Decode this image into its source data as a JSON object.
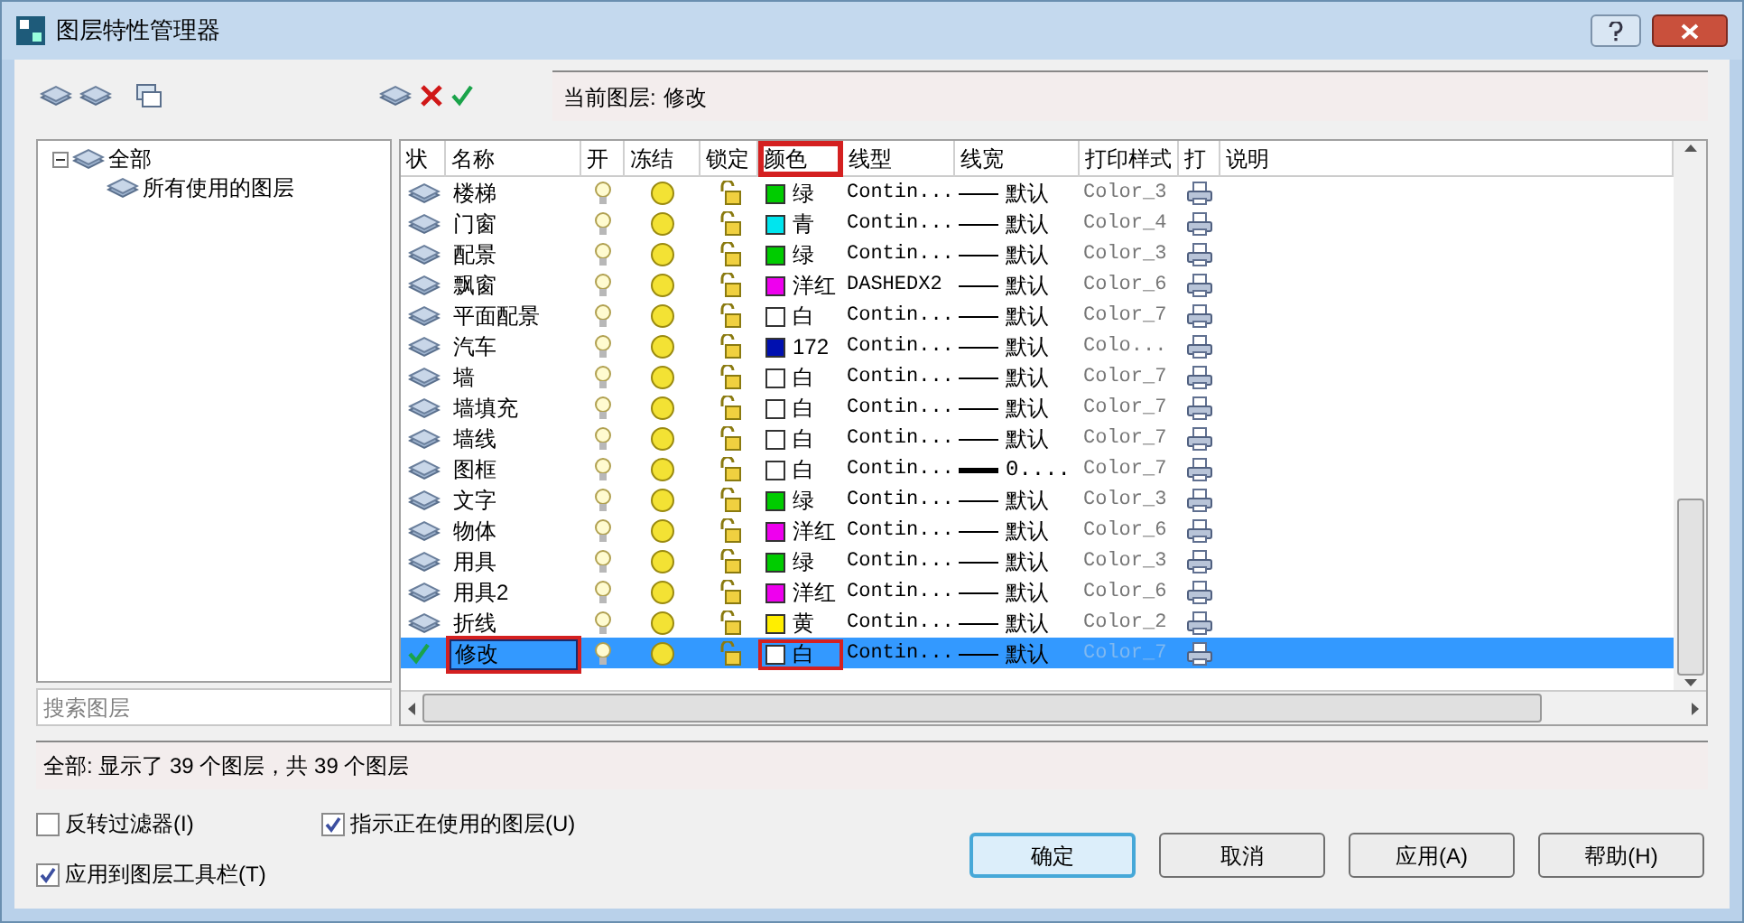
{
  "window": {
    "title": "图层特性管理器"
  },
  "current_layer": {
    "label": "当前图层:",
    "value": "修改"
  },
  "tree": [
    {
      "label": "全部",
      "expanded": true,
      "children": [
        {
          "label": "所有使用的图层"
        }
      ]
    }
  ],
  "search": {
    "placeholder": "搜索图层"
  },
  "table": {
    "columns": [
      {
        "label": "状",
        "highlight": false
      },
      {
        "label": "名称",
        "highlight": false
      },
      {
        "label": "开",
        "highlight": false
      },
      {
        "label": "冻结",
        "highlight": false
      },
      {
        "label": "锁定",
        "highlight": false
      },
      {
        "label": "颜色",
        "highlight": true
      },
      {
        "label": "线型",
        "highlight": false
      },
      {
        "label": "线宽",
        "highlight": false
      },
      {
        "label": "打印样式",
        "highlight": false
      },
      {
        "label": "打",
        "highlight": false
      },
      {
        "label": "说明",
        "highlight": false
      }
    ],
    "rows": [
      {
        "name": "楼梯",
        "color": "#00cc00",
        "color_name": "绿",
        "linetype": "Contin...",
        "lineweight": "默认",
        "heavy": false,
        "plot_style": "Color_3",
        "selected": false,
        "current": false,
        "highlight": false
      },
      {
        "name": "门窗",
        "color": "#00e5ee",
        "color_name": "青",
        "linetype": "Contin...",
        "lineweight": "默认",
        "heavy": false,
        "plot_style": "Color_4",
        "selected": false,
        "current": false,
        "highlight": false
      },
      {
        "name": "配景",
        "color": "#00cc00",
        "color_name": "绿",
        "linetype": "Contin...",
        "lineweight": "默认",
        "heavy": false,
        "plot_style": "Color_3",
        "selected": false,
        "current": false,
        "highlight": false
      },
      {
        "name": "飘窗",
        "color": "#ee00ee",
        "color_name": "洋红",
        "linetype": "DASHEDX2",
        "lineweight": "默认",
        "heavy": false,
        "plot_style": "Color_6",
        "selected": false,
        "current": false,
        "highlight": false
      },
      {
        "name": "平面配景",
        "color": "#ffffff",
        "color_name": "白",
        "linetype": "Contin...",
        "lineweight": "默认",
        "heavy": false,
        "plot_style": "Color_7",
        "selected": false,
        "current": false,
        "highlight": false
      },
      {
        "name": "汽车",
        "color": "#0010b0",
        "color_name": "172",
        "linetype": "Contin...",
        "lineweight": "默认",
        "heavy": false,
        "plot_style": "Colo...",
        "selected": false,
        "current": false,
        "highlight": false
      },
      {
        "name": "墙",
        "color": "#ffffff",
        "color_name": "白",
        "linetype": "Contin...",
        "lineweight": "默认",
        "heavy": false,
        "plot_style": "Color_7",
        "selected": false,
        "current": false,
        "highlight": false
      },
      {
        "name": "墙填充",
        "color": "#ffffff",
        "color_name": "白",
        "linetype": "Contin...",
        "lineweight": "默认",
        "heavy": false,
        "plot_style": "Color_7",
        "selected": false,
        "current": false,
        "highlight": false
      },
      {
        "name": "墙线",
        "color": "#ffffff",
        "color_name": "白",
        "linetype": "Contin...",
        "lineweight": "默认",
        "heavy": false,
        "plot_style": "Color_7",
        "selected": false,
        "current": false,
        "highlight": false
      },
      {
        "name": "图框",
        "color": "#ffffff",
        "color_name": "白",
        "linetype": "Contin...",
        "lineweight": "0....",
        "heavy": true,
        "plot_style": "Color_7",
        "selected": false,
        "current": false,
        "highlight": false
      },
      {
        "name": "文字",
        "color": "#00cc00",
        "color_name": "绿",
        "linetype": "Contin...",
        "lineweight": "默认",
        "heavy": false,
        "plot_style": "Color_3",
        "selected": false,
        "current": false,
        "highlight": false
      },
      {
        "name": "物体",
        "color": "#ee00ee",
        "color_name": "洋红",
        "linetype": "Contin...",
        "lineweight": "默认",
        "heavy": false,
        "plot_style": "Color_6",
        "selected": false,
        "current": false,
        "highlight": false
      },
      {
        "name": "用具",
        "color": "#00cc00",
        "color_name": "绿",
        "linetype": "Contin...",
        "lineweight": "默认",
        "heavy": false,
        "plot_style": "Color_3",
        "selected": false,
        "current": false,
        "highlight": false
      },
      {
        "name": "用具2",
        "color": "#ee00ee",
        "color_name": "洋红",
        "linetype": "Contin...",
        "lineweight": "默认",
        "heavy": false,
        "plot_style": "Color_6",
        "selected": false,
        "current": false,
        "highlight": false
      },
      {
        "name": "折线",
        "color": "#ffee00",
        "color_name": "黄",
        "linetype": "Contin...",
        "lineweight": "默认",
        "heavy": false,
        "plot_style": "Color_2",
        "selected": false,
        "current": false,
        "highlight": false
      },
      {
        "name": "修改",
        "color": "#ffffff",
        "color_name": "白",
        "linetype": "Contin...",
        "lineweight": "默认",
        "heavy": false,
        "plot_style": "Color_7",
        "selected": true,
        "current": true,
        "highlight": true
      }
    ]
  },
  "status": "全部: 显示了 39 个图层，共 39 个图层",
  "options": [
    {
      "label": "反转过滤器(I)",
      "checked": false
    },
    {
      "label": "指示正在使用的图层(U)",
      "checked": true
    },
    {
      "label": "应用到图层工具栏(T)",
      "checked": true
    }
  ],
  "buttons": [
    {
      "label": "确定",
      "default": true
    },
    {
      "label": "取消",
      "default": false
    },
    {
      "label": "应用(A)",
      "default": false
    },
    {
      "label": "帮助(H)",
      "default": false
    }
  ]
}
